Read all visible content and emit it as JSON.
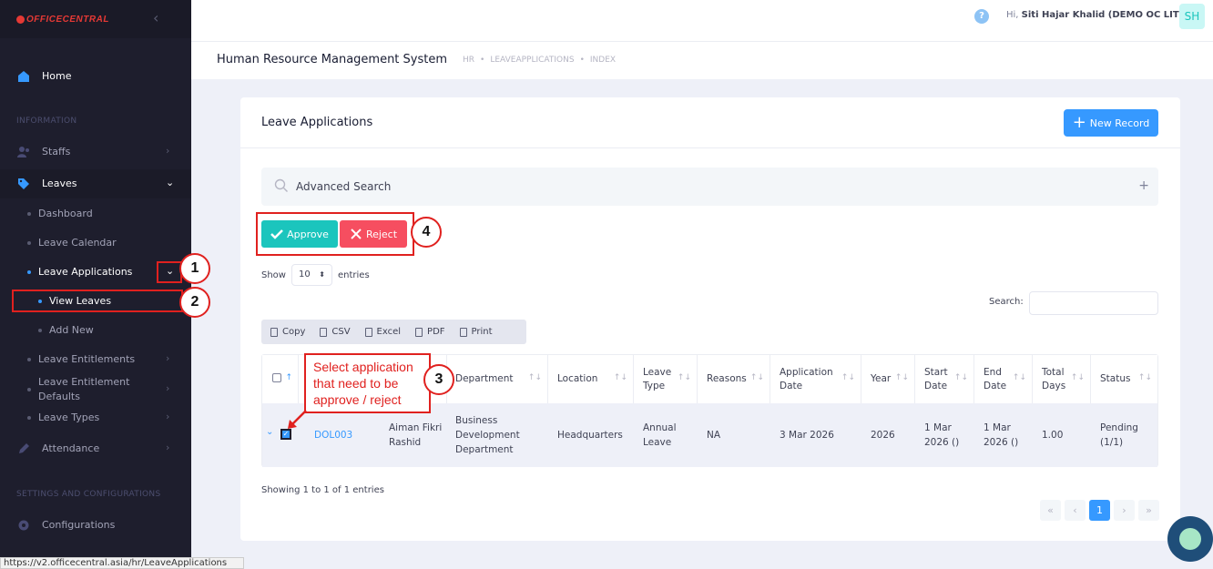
{
  "brand": {
    "logo_text": "OFFICECENTRAL"
  },
  "sidebar": {
    "home": "Home",
    "section_info": "INFORMATION",
    "staffs": "Staffs",
    "leaves": "Leaves",
    "leave_sub": [
      {
        "label": "Dashboard"
      },
      {
        "label": "Leave Calendar"
      },
      {
        "label": "Leave Applications"
      },
      {
        "label": "View Leaves"
      },
      {
        "label": "Add New"
      },
      {
        "label": "Leave Entitlements"
      },
      {
        "label": "Leave Entitlement Defaults"
      },
      {
        "label": "Leave Types"
      }
    ],
    "attendance": "Attendance",
    "section_settings": "SETTINGS AND CONFIGURATIONS",
    "configurations": "Configurations"
  },
  "topbar": {
    "greeting_prefix": "Hi,",
    "user_name": "Siti Hajar Khalid (DEMO OC LITE)",
    "avatar_initials": "SH"
  },
  "subheader": {
    "title": "Human Resource Management System",
    "breadcrumbs": [
      "HR",
      "•",
      "LEAVEAPPLICATIONS",
      "•",
      "INDEX"
    ]
  },
  "card": {
    "title": "Leave Applications",
    "new_record": "New Record",
    "advanced_search": "Advanced Search",
    "approve": "Approve",
    "reject": "Reject",
    "show": "Show",
    "entries_count": "10",
    "entries": "entries",
    "search_label": "Search:",
    "export": [
      "Copy",
      "CSV",
      "Excel",
      "PDF",
      "Print"
    ]
  },
  "table": {
    "headers": [
      "Department",
      "Location",
      "Leave Type",
      "Reasons",
      "Application Date",
      "Year",
      "Start Date",
      "End Date",
      "Total Days",
      "Status"
    ],
    "row": {
      "id": "DOL003",
      "name": "Aiman Fikri Rashid",
      "department": "Business Development Department",
      "location": "Headquarters",
      "leave_type": "Annual Leave",
      "reasons": "NA",
      "application_date": "3 Mar 2026",
      "year": "2026",
      "start_date": "1 Mar 2026 ()",
      "end_date": "1 Mar 2026 ()",
      "total_days": "1.00",
      "status": "Pending (1/1)"
    },
    "footer_info": "Showing 1 to 1 of 1 entries",
    "pager": [
      "«",
      "‹",
      "1",
      "›",
      "»"
    ]
  },
  "annotations": {
    "step1": "1",
    "step2": "2",
    "step3": "3",
    "step4": "4",
    "note": "Select application that need to be approve / reject"
  },
  "status_bar_url": "https://v2.officecentral.asia/hr/LeaveApplications",
  "colors": {
    "primary": "#3699ff",
    "approve": "#1bc5bd",
    "reject": "#f64e60",
    "annotation": "#e0211f",
    "sidebar": "#1e1e2d"
  }
}
